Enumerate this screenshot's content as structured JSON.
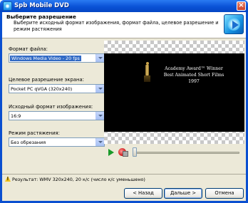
{
  "window": {
    "title": "Spb Mobile DVD",
    "close_symbol": "×"
  },
  "header": {
    "title": "Выберите разрешение",
    "description": "Выберите исходный формат изображения, формат файла, целевое разрешение и режим растяжения"
  },
  "fields": [
    {
      "label": "Формат файла:",
      "value": "Windows Media Video - 20 fps",
      "focused": true
    },
    {
      "label": "Целевое разрешение экрана:",
      "value": "Pocket PC qVGA (320x240)"
    },
    {
      "label": "Исходный формат изображения:",
      "value": "16:9"
    },
    {
      "label": "Режим растяжения:",
      "value": "Без обрезания"
    }
  ],
  "preview": {
    "lines": [
      "Academy Award™ Winner",
      "Best Animated Short Films",
      "1997"
    ]
  },
  "controls": {
    "play_icon": "play-icon",
    "record_icon": "stop-record-icon",
    "position": 0.0
  },
  "status": {
    "icon": "warning-icon",
    "text": "Результат: WMV 320x240, 20 к/с (число к/с уменьшено)"
  },
  "buttons": {
    "back": "< Назад",
    "next": "Дальше >",
    "cancel": "Отмена"
  }
}
